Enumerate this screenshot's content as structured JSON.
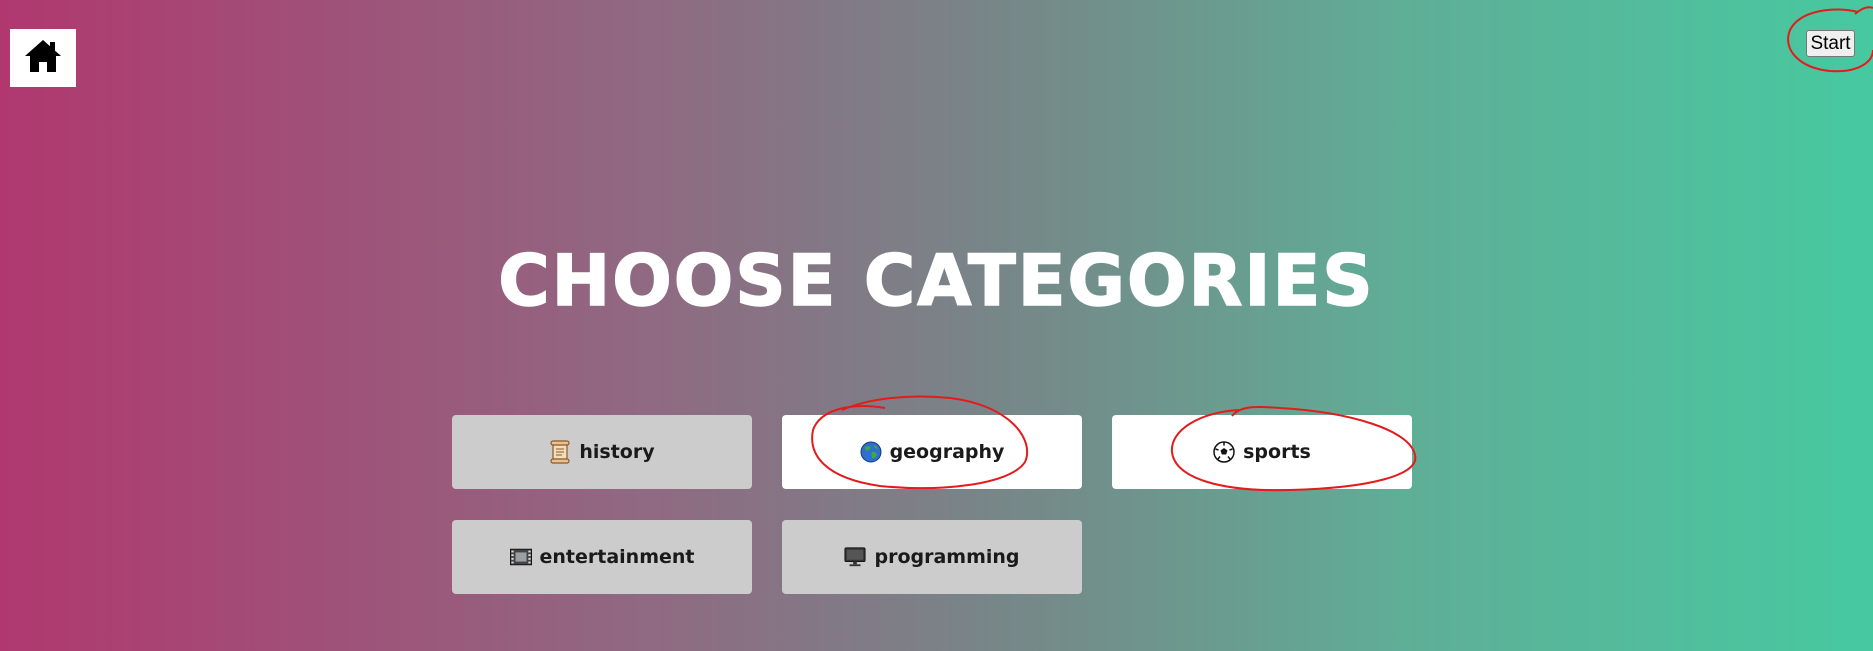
{
  "home": {
    "icon": "home-icon"
  },
  "start_button": {
    "label": "Start"
  },
  "title": "CHOOSE CATEGORIES",
  "categories": [
    {
      "label": "history",
      "icon": "scroll-icon",
      "selected": false
    },
    {
      "label": "geography",
      "icon": "globe-icon",
      "selected": true
    },
    {
      "label": "sports",
      "icon": "soccer-ball-icon",
      "selected": true
    },
    {
      "label": "entertainment",
      "icon": "film-strip-icon",
      "selected": false
    },
    {
      "label": "programming",
      "icon": "computer-monitor-icon",
      "selected": false
    }
  ],
  "colors": {
    "gradient_left": "#b0386f",
    "gradient_right": "#47c9a0",
    "selected_bg": "#ffffff",
    "unselected_bg": "#cccccc",
    "annotation": "#e21c1c"
  }
}
